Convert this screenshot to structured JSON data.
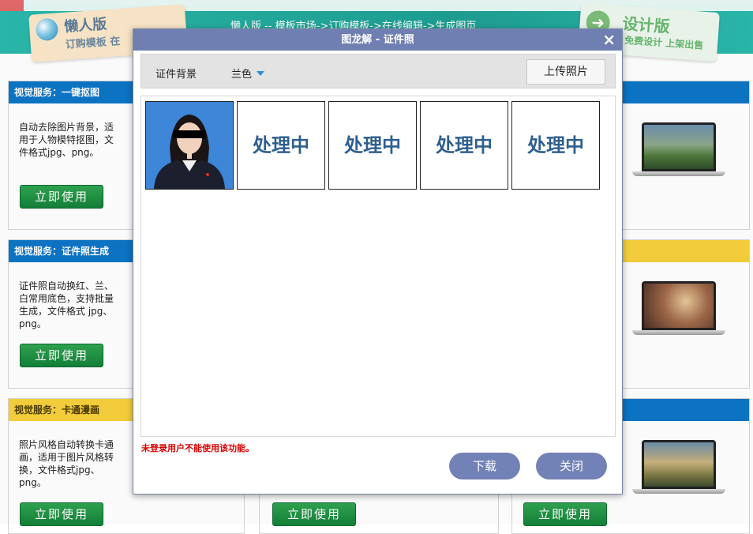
{
  "banner": {
    "lazy_title": "懒人版",
    "lazy_sub": "订购模板 在",
    "nav": "懒人版 -- 模板市场->订购模板->在线编辑->生成图页",
    "design_title": "设计版",
    "design_sub": "免费设计 上架出售"
  },
  "cards": [
    {
      "title": "视觉服务：一键抠图",
      "desc": "自动去除图片背景，适用于人物模特抠图，文件格式jpg、png。",
      "button": "立即使用"
    },
    {
      "title": "视觉服务：证件照生成",
      "desc": "证件照自动换红、兰、白常用底色，支持批量生成，文件格式 jpg、png。",
      "button": "立即使用"
    },
    {
      "title": "视觉服务：卡通漫画",
      "desc": "照片风格自动转换卡通画，适用于图片风格转换，文件格式jpg、png。",
      "button": "立即使用"
    }
  ],
  "bottom_buttons": [
    "立即使用",
    "立即使用"
  ],
  "colors": {
    "header_blue": "#0d76c6",
    "header_yellow": "#f7d13c",
    "modal_accent": "#6f7fb1",
    "button_green": "#14813a",
    "warning_red": "#d80000"
  },
  "modal": {
    "title": "图龙解 - 证件照",
    "close": "×",
    "background_label": "证件背景",
    "background_value": "兰色",
    "upload": "上传照片",
    "processing": [
      "处理中",
      "处理中",
      "处理中",
      "处理中"
    ],
    "warning": "未登录用户不能使用该功能。",
    "download": "下载",
    "close_button": "关闭"
  }
}
